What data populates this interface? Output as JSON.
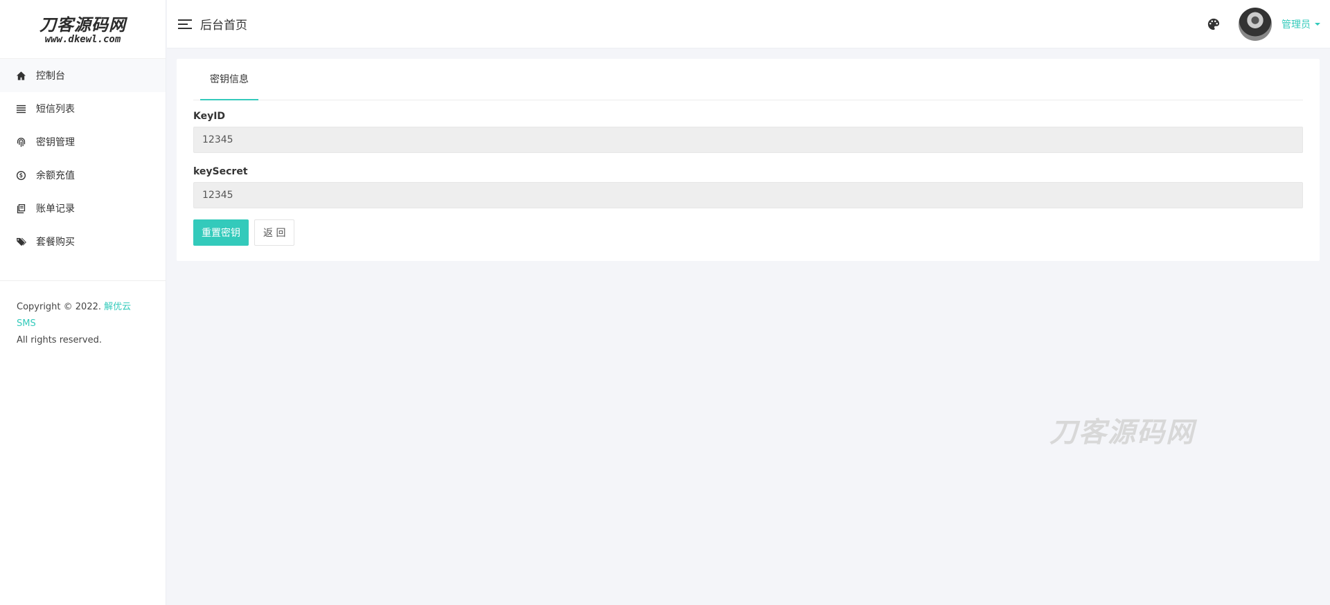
{
  "logo": {
    "main": "刀客源码网",
    "sub": "www.dkewl.com"
  },
  "sidebar": {
    "items": [
      {
        "label": "控制台",
        "icon": "home-icon"
      },
      {
        "label": "短信列表",
        "icon": "list-icon"
      },
      {
        "label": "密钥管理",
        "icon": "fingerprint-icon"
      },
      {
        "label": "余额充值",
        "icon": "dollar-circle-icon"
      },
      {
        "label": "账单记录",
        "icon": "book-icon"
      },
      {
        "label": "套餐购买",
        "icon": "tags-icon"
      }
    ],
    "copyright_prefix": "Copyright © 2022.",
    "copyright_link": "解优云SMS",
    "copyright_suffix": "All rights reserved."
  },
  "header": {
    "title": "后台首页",
    "user_name": "管理员",
    "palette_icon": "palette-icon"
  },
  "main": {
    "tab_label": "密钥信息",
    "key_id_label": "KeyID",
    "key_id_value": "12345",
    "key_secret_label": "keySecret",
    "key_secret_value": "12345",
    "reset_button": "重置密钥",
    "back_button": "返 回"
  },
  "watermark": "刀客源码网",
  "colors": {
    "accent": "#33cabb",
    "background": "#f4f5f9"
  }
}
